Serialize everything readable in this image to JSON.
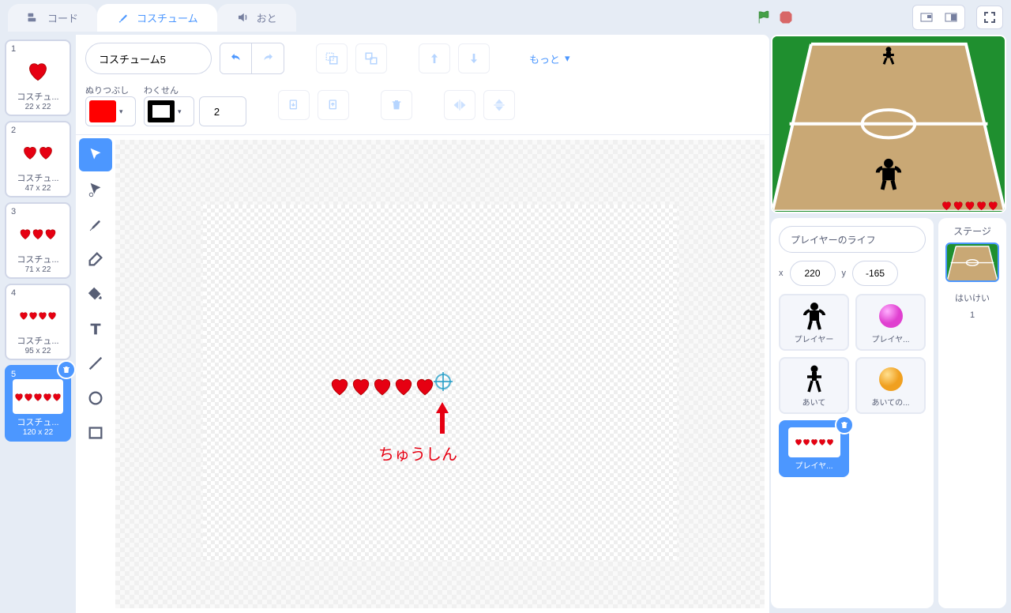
{
  "tabs": {
    "code": "コード",
    "costumes": "コスチューム",
    "sounds": "おと"
  },
  "toolbar": {
    "costume_name": "コスチューム5",
    "more_label": "もっと",
    "fill_label": "ぬりつぶし",
    "outline_label": "わくせん",
    "outline_width": "2",
    "fill_color": "#ff0000",
    "outline_color": "#000000"
  },
  "costumes": [
    {
      "num": "1",
      "name": "コスチュ...",
      "size": "22 x 22",
      "hearts": 1
    },
    {
      "num": "2",
      "name": "コスチュ...",
      "size": "47 x 22",
      "hearts": 2
    },
    {
      "num": "3",
      "name": "コスチュ...",
      "size": "71 x 22",
      "hearts": 3
    },
    {
      "num": "4",
      "name": "コスチュ...",
      "size": "95 x 22",
      "hearts": 4
    },
    {
      "num": "5",
      "name": "コスチュ...",
      "size": "120 x 22",
      "hearts": 5
    }
  ],
  "annotation": {
    "text": "ちゅうしん"
  },
  "sprite_info": {
    "name": "プレイヤーのライフ",
    "x_label": "x",
    "x_value": "220",
    "y_label": "y",
    "y_value": "-165"
  },
  "sprites": [
    {
      "label": "プレイヤー"
    },
    {
      "label": "プレイヤ..."
    },
    {
      "label": "あいて"
    },
    {
      "label": "あいての..."
    },
    {
      "label": "プレイヤ..."
    }
  ],
  "stage": {
    "title": "ステージ",
    "backdrop_label": "はいけい",
    "backdrop_count": "1"
  }
}
